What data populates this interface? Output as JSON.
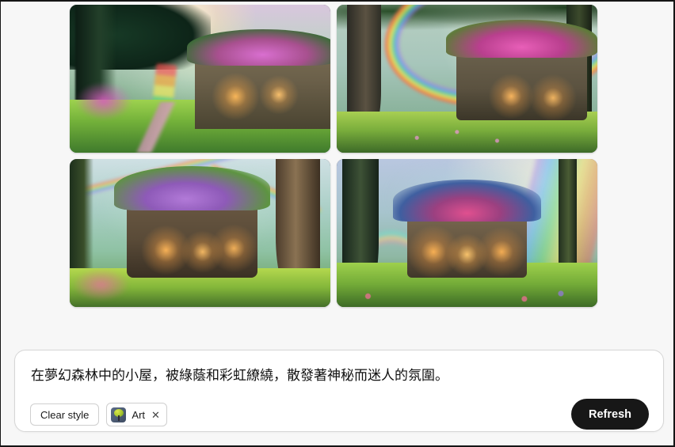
{
  "results": {
    "images": [
      {
        "alt": "Fairy-tale cottage with flower-covered roof in a misty forest, rainbow beam and winding pink path",
        "variant": "c1"
      },
      {
        "alt": "Cottage with magenta blossom roof under a large arcing rainbow between tall forest trees",
        "variant": "c2"
      },
      {
        "alt": "Moss and purple-flower cottage with a tower, twin rainbows over a bright green meadow",
        "variant": "c3"
      },
      {
        "alt": "Round-windowed glowing cottage with pink roof, rainbows on both sides in a deep forest clearing",
        "variant": "c4"
      }
    ]
  },
  "prompt": {
    "text": "在夢幻森林中的小屋，被綠蔭和彩虹繚繞，散發著神秘而迷人的氛圍。",
    "placeholder": "在夢幻森林中的小屋，被綠蔭和彩虹繚繞，散發著神秘而迷人的氛圍。"
  },
  "controls": {
    "clear_style_label": "Clear style",
    "style_chip": {
      "label": "Art",
      "remove_label": "✕",
      "thumb_icon": "tree-thumbnail-icon"
    },
    "refresh_label": "Refresh"
  },
  "colors": {
    "refresh_bg": "#171717",
    "refresh_text": "#ffffff",
    "panel_bg": "#ffffff",
    "panel_border": "#d6d6d6",
    "page_bg": "#f7f7f7",
    "window_border": "#151515"
  }
}
